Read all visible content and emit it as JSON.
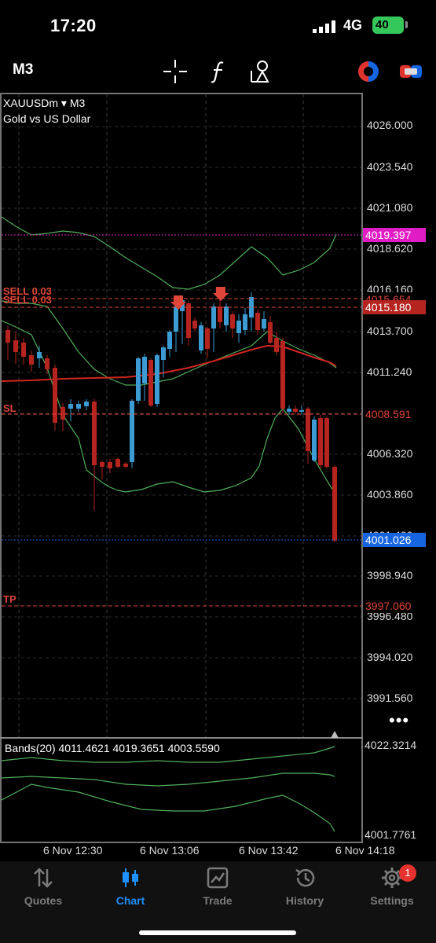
{
  "status": {
    "time": "17:20",
    "network": "4G",
    "battery": "40"
  },
  "toolbar": {
    "timeframe": "M3",
    "icons": [
      "crosshair-icon",
      "function-icon",
      "objects-icon",
      "trade-toggle-icon",
      "one-click-trading-icon"
    ]
  },
  "chart": {
    "symbol": "XAUUSDm",
    "symbol_timeframe": "M3",
    "description": "Gold vs US Dollar",
    "price_axis": [
      "4026.000",
      "4023.540",
      "4021.080",
      "4018.620",
      "4016.160",
      "4013.700",
      "4011.240",
      "4006.320",
      "4003.860",
      "4001.400",
      "3998.940",
      "3996.480",
      "3994.020",
      "3991.560"
    ],
    "price_tags": {
      "upper_band": "4019.397",
      "sell_open_1": "4015.654",
      "sell_open_2": "4015.180",
      "stop_loss": "4008.591",
      "current_bid": "4001.026",
      "take_profit": "3997.060"
    },
    "order_labels": {
      "sell_1": "SELL 0.03",
      "sell_2": "SELL 0.03",
      "sl": "SL",
      "tp": "TP"
    },
    "colors": {
      "bull": "#3d9bd3",
      "bear": "#b5241f",
      "band": "#4fae5c",
      "ma": "#d0261f",
      "upper_tag": "#e01cc4",
      "bid_tag": "#1565e0",
      "order": "#e0453a"
    },
    "more_icon": "more-dots-icon"
  },
  "indicator": {
    "label": "Bands(20) 4011.4621 4019.3651 4003.5590",
    "axis_top": "4022.3214",
    "axis_bottom": "4001.7761"
  },
  "time_axis": [
    "6 Nov 12:30",
    "6 Nov 13:06",
    "6 Nov 13:42",
    "6 Nov 14:18"
  ],
  "tabs": [
    {
      "label": "Quotes",
      "icon": "quotes-icon"
    },
    {
      "label": "Chart",
      "icon": "chart-icon"
    },
    {
      "label": "Trade",
      "icon": "trade-icon"
    },
    {
      "label": "History",
      "icon": "history-icon"
    },
    {
      "label": "Settings",
      "icon": "gear-icon",
      "badge": "1"
    }
  ]
}
